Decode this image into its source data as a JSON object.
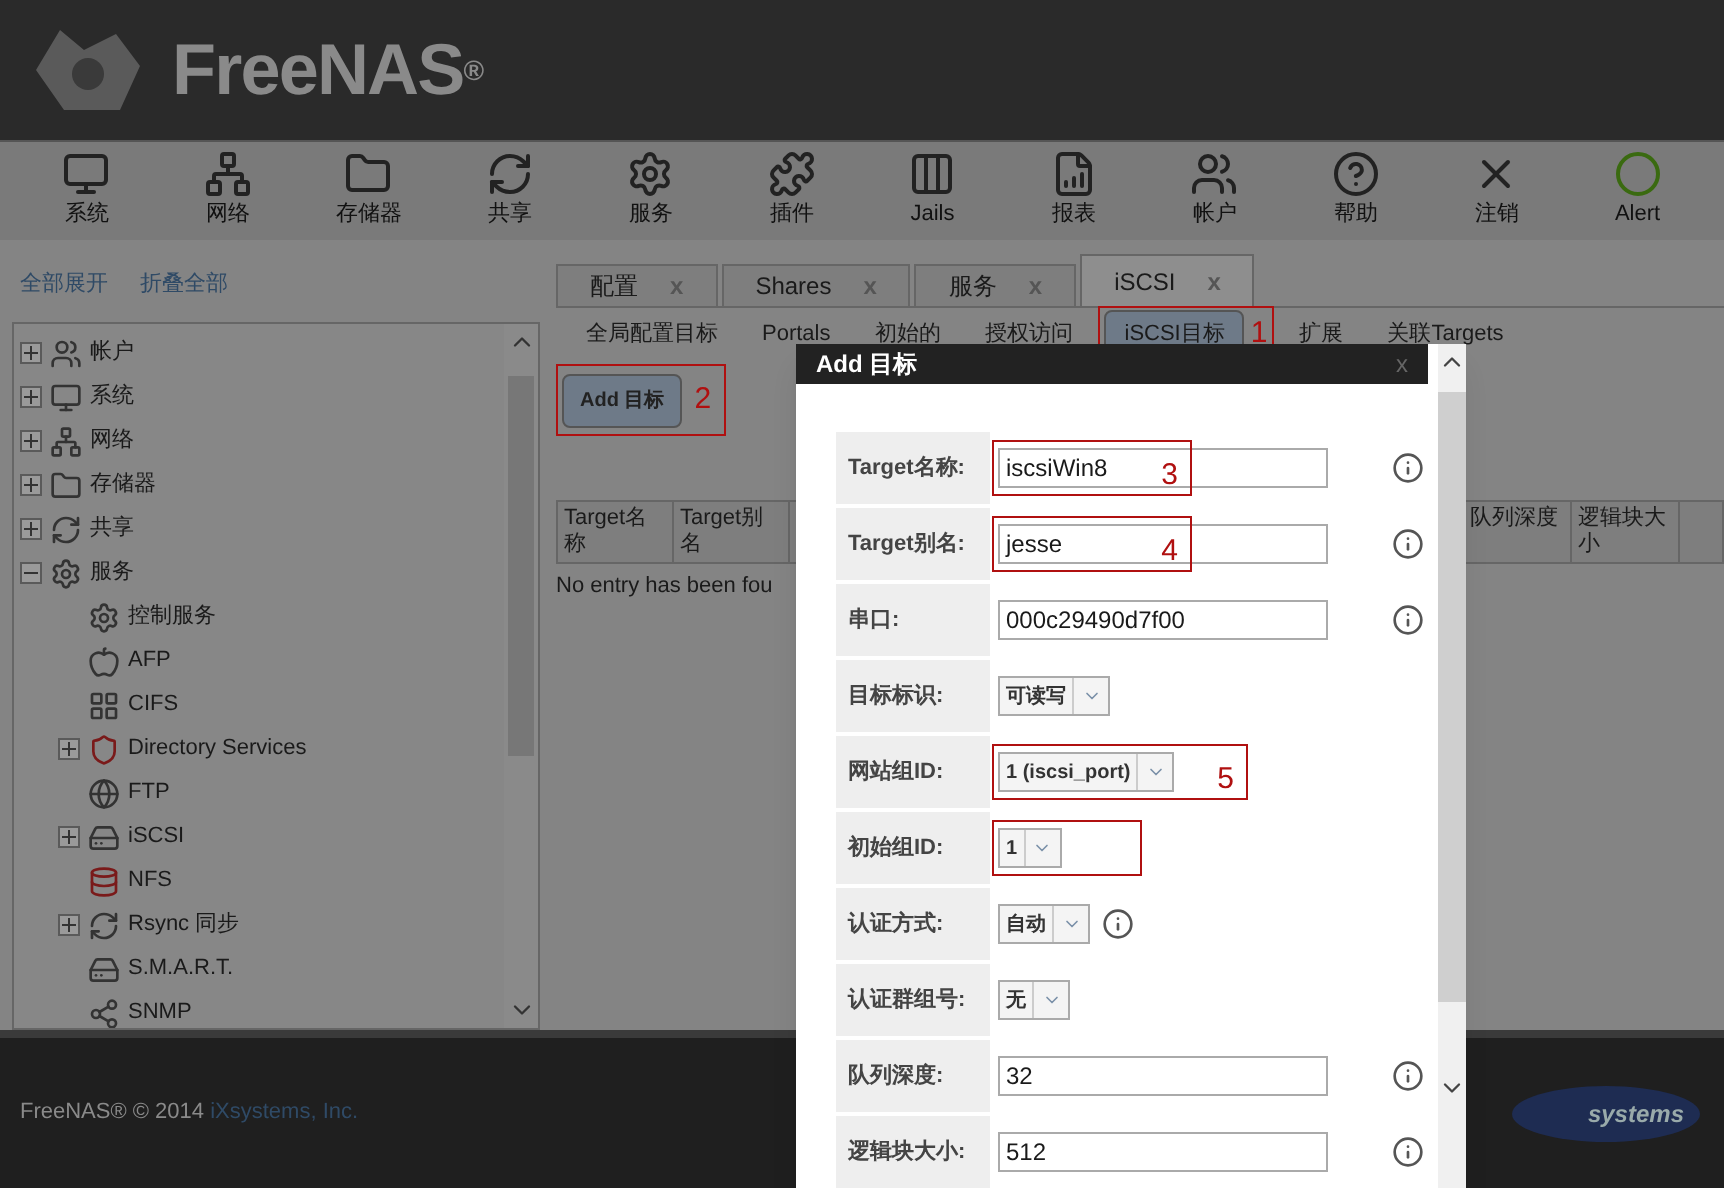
{
  "header": {
    "logo": "FreeNAS",
    "logo_mark": "®"
  },
  "toolbar": [
    {
      "label": "系统"
    },
    {
      "label": "网络"
    },
    {
      "label": "存储器"
    },
    {
      "label": "共享"
    },
    {
      "label": "服务"
    },
    {
      "label": "插件"
    },
    {
      "label": "Jails"
    },
    {
      "label": "报表"
    },
    {
      "label": "帐户"
    },
    {
      "label": "帮助"
    },
    {
      "label": "注销"
    },
    {
      "label": "Alert"
    }
  ],
  "sidebar": {
    "links": [
      "全部展开",
      "折叠全部"
    ],
    "tree": [
      {
        "label": "帐户",
        "expanded": false
      },
      {
        "label": "系统",
        "expanded": false
      },
      {
        "label": "网络",
        "expanded": false
      },
      {
        "label": "存储器",
        "expanded": false
      },
      {
        "label": "共享",
        "expanded": false
      },
      {
        "label": "服务",
        "expanded": true,
        "children": [
          {
            "label": "控制服务",
            "kind": "leaf"
          },
          {
            "label": "AFP",
            "kind": "leaf"
          },
          {
            "label": "CIFS",
            "kind": "leaf"
          },
          {
            "label": "Directory Services",
            "kind": "folder"
          },
          {
            "label": "FTP",
            "kind": "leaf"
          },
          {
            "label": "iSCSI",
            "kind": "folder"
          },
          {
            "label": "NFS",
            "kind": "leaf"
          },
          {
            "label": "Rsync 同步",
            "kind": "folder"
          },
          {
            "label": "S.M.A.R.T.",
            "kind": "leaf"
          },
          {
            "label": "SNMP",
            "kind": "leaf"
          }
        ]
      }
    ]
  },
  "tabs": [
    {
      "label": "配置",
      "close": "x",
      "selected": false
    },
    {
      "label": "Shares",
      "close": "x",
      "selected": false
    },
    {
      "label": "服务",
      "close": "x",
      "selected": false
    },
    {
      "label": "iSCSI",
      "close": "x",
      "selected": true
    }
  ],
  "subtabs": [
    {
      "label": "全局配置目标",
      "selected": false
    },
    {
      "label": "Portals",
      "selected": false
    },
    {
      "label": "初始的",
      "selected": false
    },
    {
      "label": "授权访问",
      "selected": false
    },
    {
      "label": "iSCSI目标",
      "selected": true,
      "annotation": "1"
    },
    {
      "label": "扩展",
      "selected": false
    },
    {
      "label": "关联Targets",
      "selected": false
    }
  ],
  "add_button": {
    "label": "Add 目标",
    "annotation": "2"
  },
  "table": {
    "columns": [
      "Target名称",
      "Target别名",
      "队列深度",
      "逻辑块大小"
    ],
    "empty_message": "No entry has been fou"
  },
  "dialog": {
    "title": "Add 目标",
    "close": "x",
    "fields": [
      {
        "label": "Target名称:",
        "kind": "text",
        "value": "iscsiWin8",
        "info": true,
        "annotated": true,
        "annotation": "3"
      },
      {
        "label": "Target别名:",
        "kind": "text",
        "value": "jesse",
        "info": true,
        "annotated": true,
        "annotation": "4"
      },
      {
        "label": "串口:",
        "kind": "text",
        "value": "000c29490d7f00",
        "info": true,
        "annotated": false
      },
      {
        "label": "目标标识:",
        "kind": "select",
        "value": "可读写",
        "info": false,
        "annotated": false
      },
      {
        "label": "网站组ID:",
        "kind": "select",
        "value": "1 (iscsi_port)",
        "info": false,
        "annotated": true,
        "annotation": "5"
      },
      {
        "label": "初始组ID:",
        "kind": "select",
        "value": "1",
        "info": false,
        "annotated": true
      },
      {
        "label": "认证方式:",
        "kind": "select",
        "value": "自动",
        "info": true,
        "annotated": false
      },
      {
        "label": "认证群组号:",
        "kind": "select",
        "value": "无",
        "info": false,
        "annotated": false
      },
      {
        "label": "队列深度:",
        "kind": "text",
        "value": "32",
        "info": true,
        "annotated": false
      },
      {
        "label": "逻辑块大小:",
        "kind": "text",
        "value": "512",
        "info": true,
        "annotated": false
      }
    ]
  },
  "footer": {
    "copyright": "FreeNAS® © 2014 ",
    "link": "iXsystems, Inc.",
    "logo": "systems"
  }
}
